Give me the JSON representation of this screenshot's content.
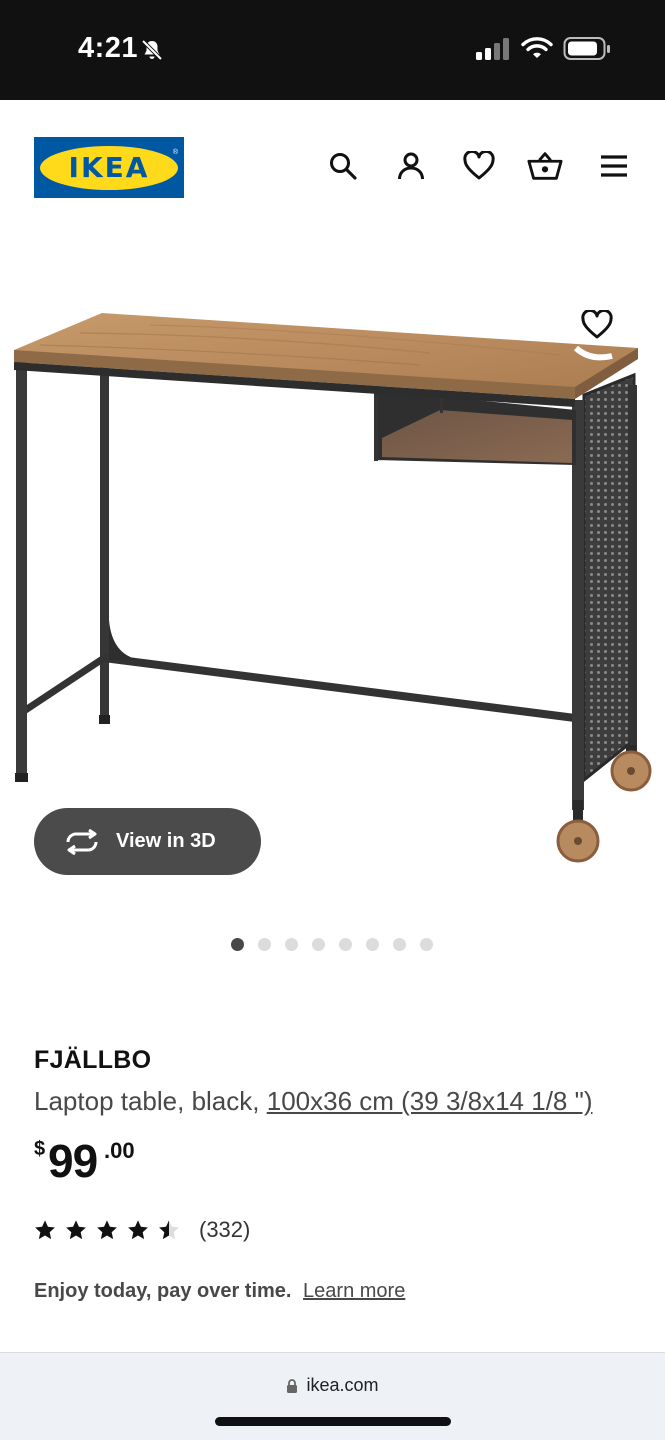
{
  "status_bar": {
    "time": "4:21",
    "icons": [
      "bell-slash-icon",
      "signal-icon",
      "wifi-icon",
      "battery-icon"
    ]
  },
  "header": {
    "logo_text": "IKEA",
    "icons": [
      "search-icon",
      "account-icon",
      "heart-icon",
      "cart-icon",
      "menu-icon"
    ]
  },
  "gallery": {
    "view_3d_label": "View in 3D",
    "image_count": 8,
    "active_index": 0
  },
  "product": {
    "name": "FJÄLLBO",
    "description": "Laptop table, black,",
    "size": "100x36 cm (39 3/8x14 1/8 \")",
    "price": {
      "currency": "$",
      "integer": "99",
      "decimal": ".00"
    },
    "rating": {
      "stars": 4.5,
      "count": "(332)"
    },
    "financing": {
      "text": "Enjoy today, pay over time.",
      "link": "Learn more"
    }
  },
  "browser": {
    "url": "ikea.com"
  },
  "colors": {
    "ikea_blue": "#0058a3",
    "ikea_yellow": "#ffda1a",
    "button_dark": "#4b4b4b",
    "text_grey": "#484848"
  }
}
